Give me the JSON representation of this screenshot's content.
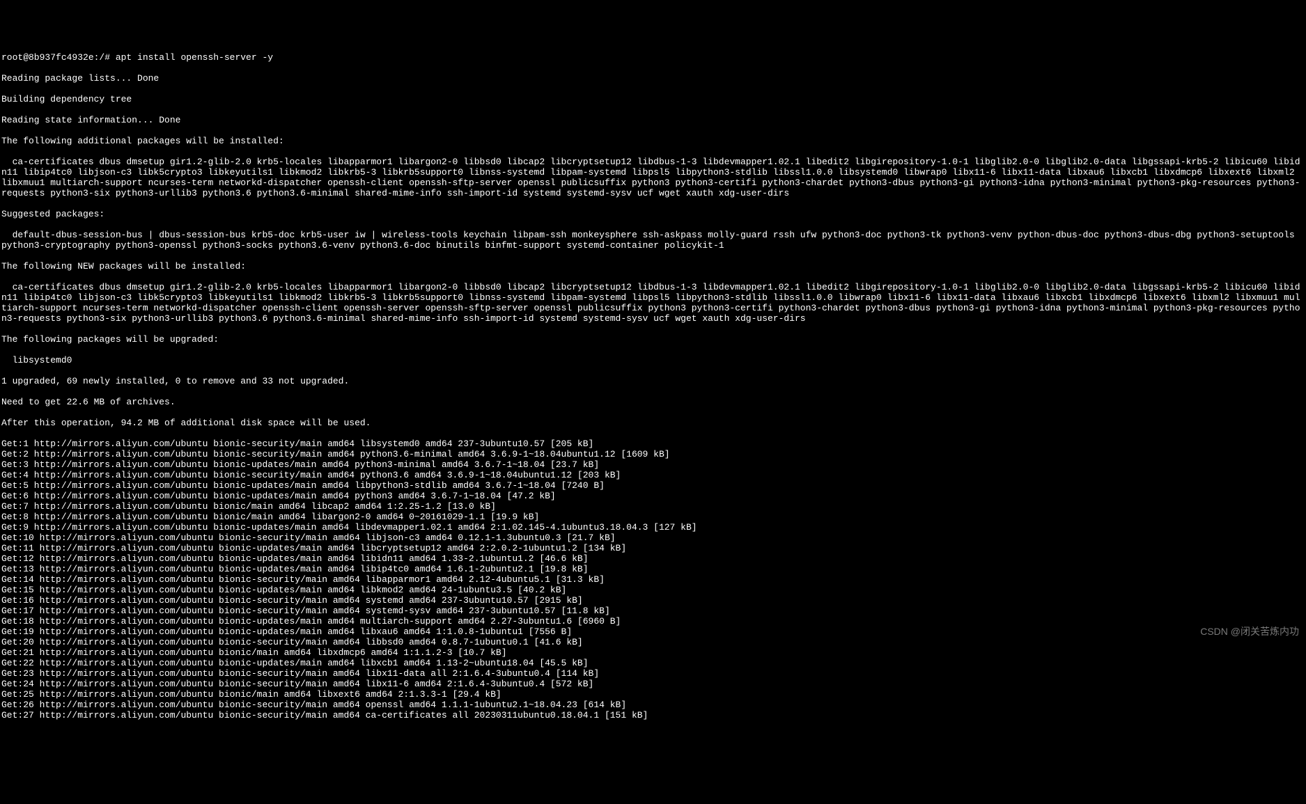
{
  "prompt_line": "root@8b937fc4932e:/# apt install openssh-server -y",
  "lines": [
    "Reading package lists... Done",
    "Building dependency tree",
    "Reading state information... Done",
    "The following additional packages will be installed:"
  ],
  "additional_pkgs": "  ca-certificates dbus dmsetup gir1.2-glib-2.0 krb5-locales libapparmor1 libargon2-0 libbsd0 libcap2 libcryptsetup12 libdbus-1-3 libdevmapper1.02.1 libedit2 libgirepository-1.0-1 libglib2.0-0 libglib2.0-data libgssapi-krb5-2 libicu60 libidn11 libip4tc0 libjson-c3 libk5crypto3 libkeyutils1 libkmod2 libkrb5-3 libkrb5support0 libnss-systemd libpam-systemd libpsl5 libpython3-stdlib libssl1.0.0 libsystemd0 libwrap0 libx11-6 libx11-data libxau6 libxcb1 libxdmcp6 libxext6 libxml2 libxmuu1 multiarch-support ncurses-term networkd-dispatcher openssh-client openssh-sftp-server openssl publicsuffix python3 python3-certifi python3-chardet python3-dbus python3-gi python3-idna python3-minimal python3-pkg-resources python3-requests python3-six python3-urllib3 python3.6 python3.6-minimal shared-mime-info ssh-import-id systemd systemd-sysv ucf wget xauth xdg-user-dirs",
  "suggested_header": "Suggested packages:",
  "suggested_pkgs": "  default-dbus-session-bus | dbus-session-bus krb5-doc krb5-user iw | wireless-tools keychain libpam-ssh monkeysphere ssh-askpass molly-guard rssh ufw python3-doc python3-tk python3-venv python-dbus-doc python3-dbus-dbg python3-setuptools python3-cryptography python3-openssl python3-socks python3.6-venv python3.6-doc binutils binfmt-support systemd-container policykit-1",
  "new_header": "The following NEW packages will be installed:",
  "new_pkgs": "  ca-certificates dbus dmsetup gir1.2-glib-2.0 krb5-locales libapparmor1 libargon2-0 libbsd0 libcap2 libcryptsetup12 libdbus-1-3 libdevmapper1.02.1 libedit2 libgirepository-1.0-1 libglib2.0-0 libglib2.0-data libgssapi-krb5-2 libicu60 libidn11 libip4tc0 libjson-c3 libk5crypto3 libkeyutils1 libkmod2 libkrb5-3 libkrb5support0 libnss-systemd libpam-systemd libpsl5 libpython3-stdlib libssl1.0.0 libwrap0 libx11-6 libx11-data libxau6 libxcb1 libxdmcp6 libxext6 libxml2 libxmuu1 multiarch-support ncurses-term networkd-dispatcher openssh-client openssh-server openssh-sftp-server openssl publicsuffix python3 python3-certifi python3-chardet python3-dbus python3-gi python3-idna python3-minimal python3-pkg-resources python3-requests python3-six python3-urllib3 python3.6 python3.6-minimal shared-mime-info ssh-import-id systemd systemd-sysv ucf wget xauth xdg-user-dirs",
  "upgrade_header": "The following packages will be upgraded:",
  "upgrade_pkgs": "  libsystemd0",
  "summary": [
    "1 upgraded, 69 newly installed, 0 to remove and 33 not upgraded.",
    "Need to get 22.6 MB of archives.",
    "After this operation, 94.2 MB of additional disk space will be used."
  ],
  "gets": [
    "Get:1 http://mirrors.aliyun.com/ubuntu bionic-security/main amd64 libsystemd0 amd64 237-3ubuntu10.57 [205 kB]",
    "Get:2 http://mirrors.aliyun.com/ubuntu bionic-security/main amd64 python3.6-minimal amd64 3.6.9-1~18.04ubuntu1.12 [1609 kB]",
    "Get:3 http://mirrors.aliyun.com/ubuntu bionic-updates/main amd64 python3-minimal amd64 3.6.7-1~18.04 [23.7 kB]",
    "Get:4 http://mirrors.aliyun.com/ubuntu bionic-security/main amd64 python3.6 amd64 3.6.9-1~18.04ubuntu1.12 [203 kB]",
    "Get:5 http://mirrors.aliyun.com/ubuntu bionic-updates/main amd64 libpython3-stdlib amd64 3.6.7-1~18.04 [7240 B]",
    "Get:6 http://mirrors.aliyun.com/ubuntu bionic-updates/main amd64 python3 amd64 3.6.7-1~18.04 [47.2 kB]",
    "Get:7 http://mirrors.aliyun.com/ubuntu bionic/main amd64 libcap2 amd64 1:2.25-1.2 [13.0 kB]",
    "Get:8 http://mirrors.aliyun.com/ubuntu bionic/main amd64 libargon2-0 amd64 0~20161029-1.1 [19.9 kB]",
    "Get:9 http://mirrors.aliyun.com/ubuntu bionic-updates/main amd64 libdevmapper1.02.1 amd64 2:1.02.145-4.1ubuntu3.18.04.3 [127 kB]",
    "Get:10 http://mirrors.aliyun.com/ubuntu bionic-security/main amd64 libjson-c3 amd64 0.12.1-1.3ubuntu0.3 [21.7 kB]",
    "Get:11 http://mirrors.aliyun.com/ubuntu bionic-updates/main amd64 libcryptsetup12 amd64 2:2.0.2-1ubuntu1.2 [134 kB]",
    "Get:12 http://mirrors.aliyun.com/ubuntu bionic-updates/main amd64 libidn11 amd64 1.33-2.1ubuntu1.2 [46.6 kB]",
    "Get:13 http://mirrors.aliyun.com/ubuntu bionic-updates/main amd64 libip4tc0 amd64 1.6.1-2ubuntu2.1 [19.8 kB]",
    "Get:14 http://mirrors.aliyun.com/ubuntu bionic-security/main amd64 libapparmor1 amd64 2.12-4ubuntu5.1 [31.3 kB]",
    "Get:15 http://mirrors.aliyun.com/ubuntu bionic-updates/main amd64 libkmod2 amd64 24-1ubuntu3.5 [40.2 kB]",
    "Get:16 http://mirrors.aliyun.com/ubuntu bionic-security/main amd64 systemd amd64 237-3ubuntu10.57 [2915 kB]",
    "Get:17 http://mirrors.aliyun.com/ubuntu bionic-security/main amd64 systemd-sysv amd64 237-3ubuntu10.57 [11.8 kB]",
    "Get:18 http://mirrors.aliyun.com/ubuntu bionic-updates/main amd64 multiarch-support amd64 2.27-3ubuntu1.6 [6960 B]",
    "Get:19 http://mirrors.aliyun.com/ubuntu bionic-updates/main amd64 libxau6 amd64 1:1.0.8-1ubuntu1 [7556 B]",
    "Get:20 http://mirrors.aliyun.com/ubuntu bionic-security/main amd64 libbsd0 amd64 0.8.7-1ubuntu0.1 [41.6 kB]",
    "Get:21 http://mirrors.aliyun.com/ubuntu bionic/main amd64 libxdmcp6 amd64 1:1.1.2-3 [10.7 kB]",
    "Get:22 http://mirrors.aliyun.com/ubuntu bionic-updates/main amd64 libxcb1 amd64 1.13-2~ubuntu18.04 [45.5 kB]",
    "Get:23 http://mirrors.aliyun.com/ubuntu bionic-security/main amd64 libx11-data all 2:1.6.4-3ubuntu0.4 [114 kB]",
    "Get:24 http://mirrors.aliyun.com/ubuntu bionic-security/main amd64 libx11-6 amd64 2:1.6.4-3ubuntu0.4 [572 kB]",
    "Get:25 http://mirrors.aliyun.com/ubuntu bionic/main amd64 libxext6 amd64 2:1.3.3-1 [29.4 kB]",
    "Get:26 http://mirrors.aliyun.com/ubuntu bionic-security/main amd64 openssl amd64 1.1.1-1ubuntu2.1~18.04.23 [614 kB]",
    "Get:27 http://mirrors.aliyun.com/ubuntu bionic-security/main amd64 ca-certificates all 20230311ubuntu0.18.04.1 [151 kB]"
  ],
  "watermark": "CSDN @闭关苦炼内功"
}
